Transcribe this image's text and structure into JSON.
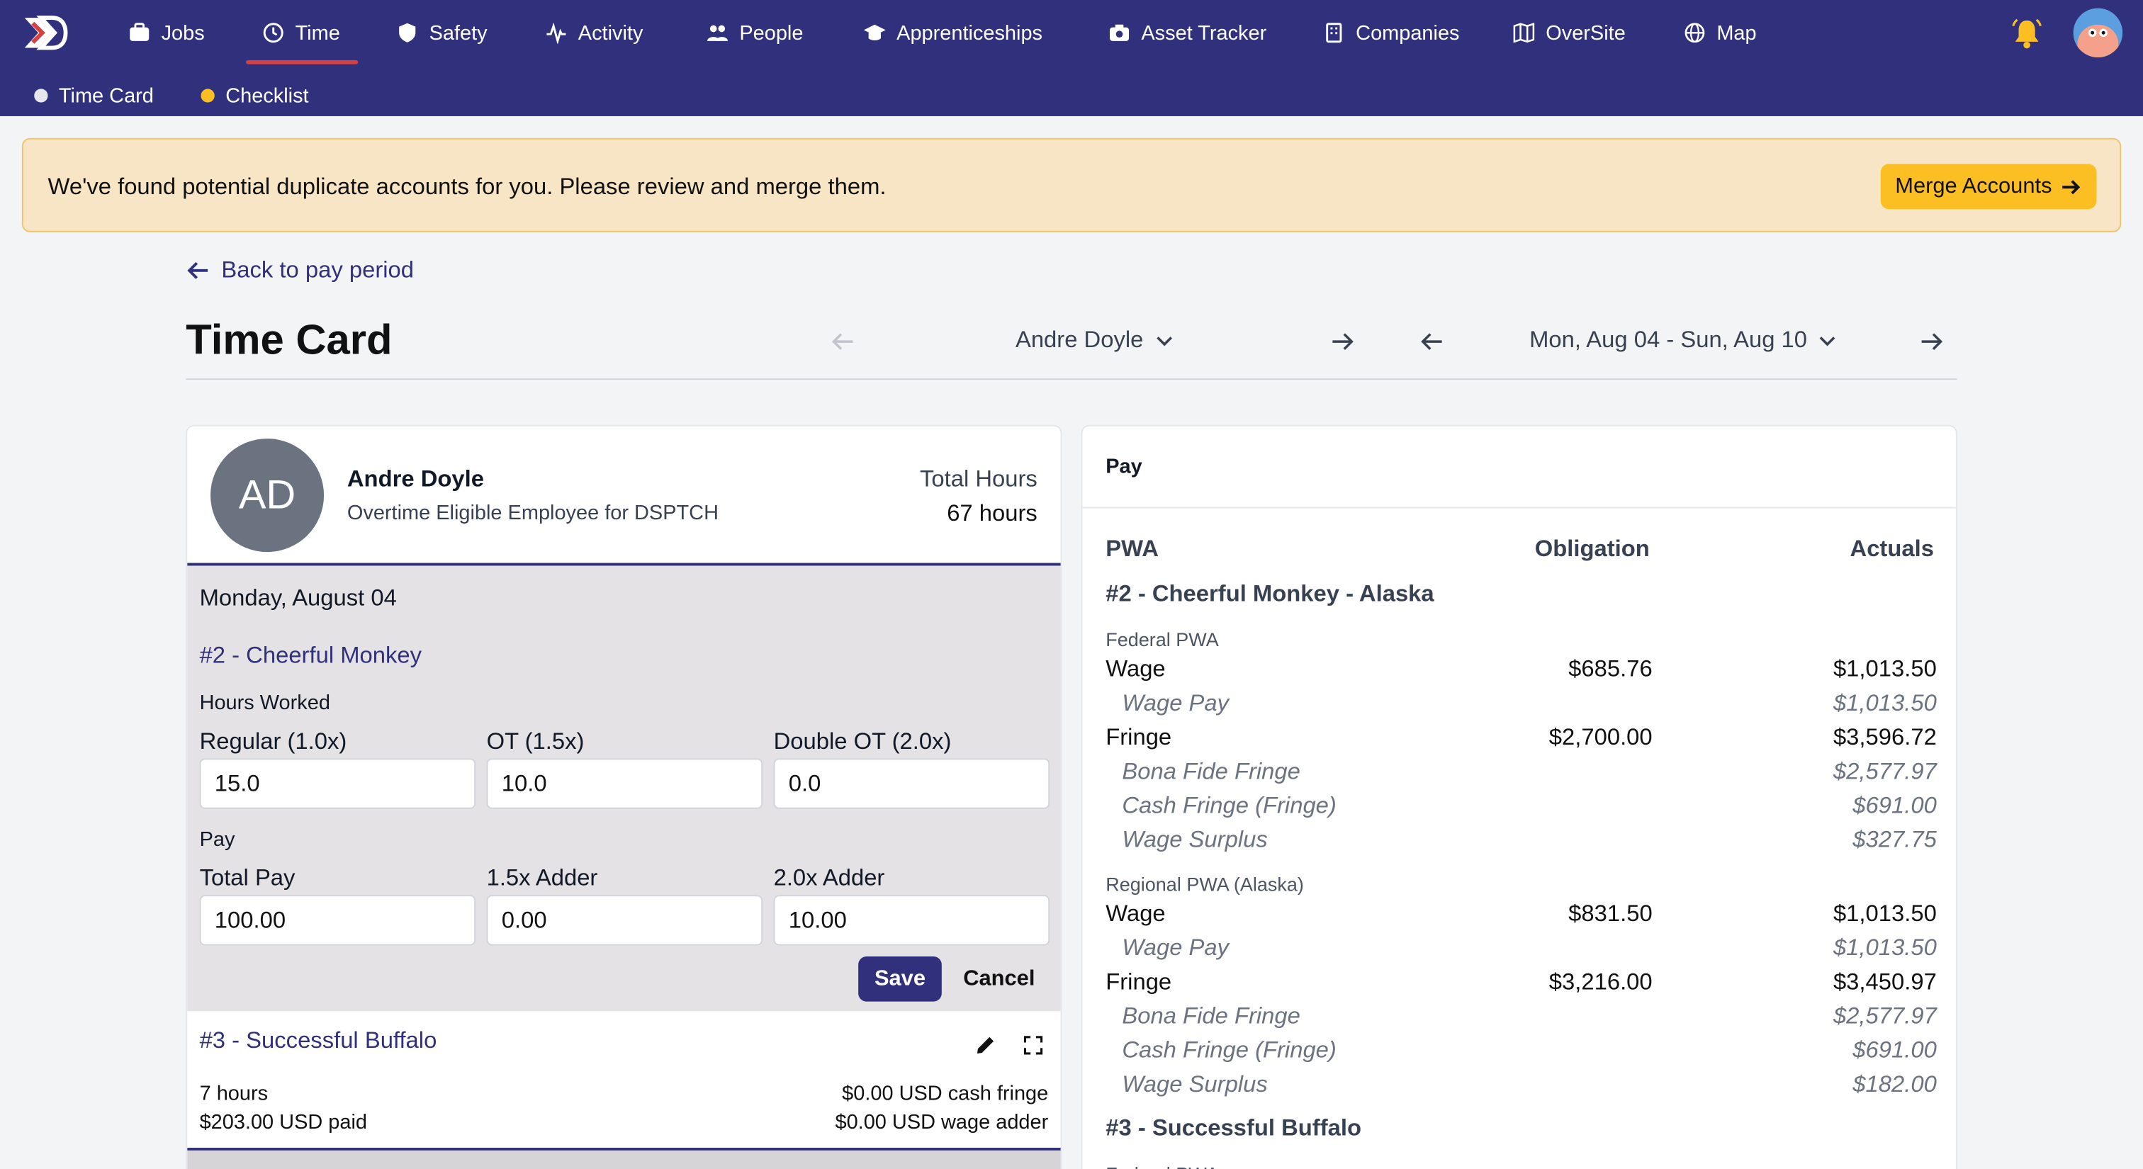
{
  "nav": {
    "items": [
      {
        "label": "Jobs",
        "icon": "briefcase-icon"
      },
      {
        "label": "Time",
        "icon": "clock-icon"
      },
      {
        "label": "Safety",
        "icon": "shield-icon"
      },
      {
        "label": "Activity",
        "icon": "pulse-icon"
      },
      {
        "label": "People",
        "icon": "people-icon"
      },
      {
        "label": "Apprenticeships",
        "icon": "graduation-cap-icon"
      },
      {
        "label": "Asset Tracker",
        "icon": "camera-icon"
      },
      {
        "label": "Companies",
        "icon": "building-icon"
      },
      {
        "label": "OverSite",
        "icon": "map-book-icon"
      },
      {
        "label": "Map",
        "icon": "globe-icon"
      }
    ],
    "active": "Time",
    "subnav": [
      {
        "label": "Time Card",
        "dot_color": "#e5e7eb"
      },
      {
        "label": "Checklist",
        "dot_color": "#fbbf24"
      }
    ]
  },
  "banner": {
    "text": "We've found potential duplicate accounts for you. Please review and merge them.",
    "button": "Merge Accounts"
  },
  "back_link": "Back to pay period",
  "page_title": "Time Card",
  "employee_selector": "Andre Doyle",
  "period_selector": "Mon, Aug 04 - Sun, Aug 10",
  "employee": {
    "initials": "AD",
    "name": "Andre Doyle",
    "subtitle": "Overtime Eligible Employee for DSPTCH",
    "total_hours_label": "Total Hours",
    "total_hours": "67 hours"
  },
  "day": {
    "title": "Monday, August 04",
    "job": "#2 - Cheerful Monkey",
    "hours_label": "Hours Worked",
    "fields_hours": [
      {
        "label": "Regular (1.0x)",
        "value": "15.0"
      },
      {
        "label": "OT (1.5x)",
        "value": "10.0"
      },
      {
        "label": "Double OT (2.0x)",
        "value": "0.0"
      }
    ],
    "pay_label": "Pay",
    "fields_pay": [
      {
        "label": "Total Pay",
        "value": "100.00"
      },
      {
        "label": "1.5x Adder",
        "value": "0.00"
      },
      {
        "label": "2.0x Adder",
        "value": "10.00"
      }
    ],
    "save": "Save",
    "cancel": "Cancel"
  },
  "job2": {
    "title": "#3 - Successful Buffalo",
    "hours": "7 hours",
    "paid": "$203.00 USD paid",
    "cash_fringe": "$0.00 USD cash fringe",
    "wage_adder": "$0.00 USD wage adder"
  },
  "pay": {
    "heading": "Pay",
    "columns": [
      "PWA",
      "Obligation",
      "Actuals"
    ],
    "rows": [
      {
        "kind": "job",
        "label": "#2 - Cheerful Monkey - Alaska",
        "obligation": "",
        "actual": ""
      },
      {
        "kind": "grp",
        "label": "Federal PWA",
        "obligation": "",
        "actual": ""
      },
      {
        "kind": "main",
        "label": "Wage",
        "obligation": "$685.76",
        "actual": "$1,013.50"
      },
      {
        "kind": "sub",
        "label": "Wage Pay",
        "obligation": "",
        "actual": "$1,013.50"
      },
      {
        "kind": "main",
        "label": "Fringe",
        "obligation": "$2,700.00",
        "actual": "$3,596.72"
      },
      {
        "kind": "sub",
        "label": "Bona Fide Fringe",
        "obligation": "",
        "actual": "$2,577.97"
      },
      {
        "kind": "sub",
        "label": "Cash Fringe (Fringe)",
        "obligation": "",
        "actual": "$691.00"
      },
      {
        "kind": "sub",
        "label": "Wage Surplus",
        "obligation": "",
        "actual": "$327.75"
      },
      {
        "kind": "grp",
        "label": "Regional PWA (Alaska)",
        "obligation": "",
        "actual": ""
      },
      {
        "kind": "main",
        "label": "Wage",
        "obligation": "$831.50",
        "actual": "$1,013.50"
      },
      {
        "kind": "sub",
        "label": "Wage Pay",
        "obligation": "",
        "actual": "$1,013.50"
      },
      {
        "kind": "main",
        "label": "Fringe",
        "obligation": "$3,216.00",
        "actual": "$3,450.97"
      },
      {
        "kind": "sub",
        "label": "Bona Fide Fringe",
        "obligation": "",
        "actual": "$2,577.97"
      },
      {
        "kind": "sub",
        "label": "Cash Fringe (Fringe)",
        "obligation": "",
        "actual": "$691.00"
      },
      {
        "kind": "sub",
        "label": "Wage Surplus",
        "obligation": "",
        "actual": "$182.00"
      },
      {
        "kind": "job",
        "label": "#3 - Successful Buffalo",
        "obligation": "",
        "actual": ""
      },
      {
        "kind": "grp",
        "label": "Federal PWA",
        "obligation": "",
        "actual": ""
      }
    ]
  }
}
